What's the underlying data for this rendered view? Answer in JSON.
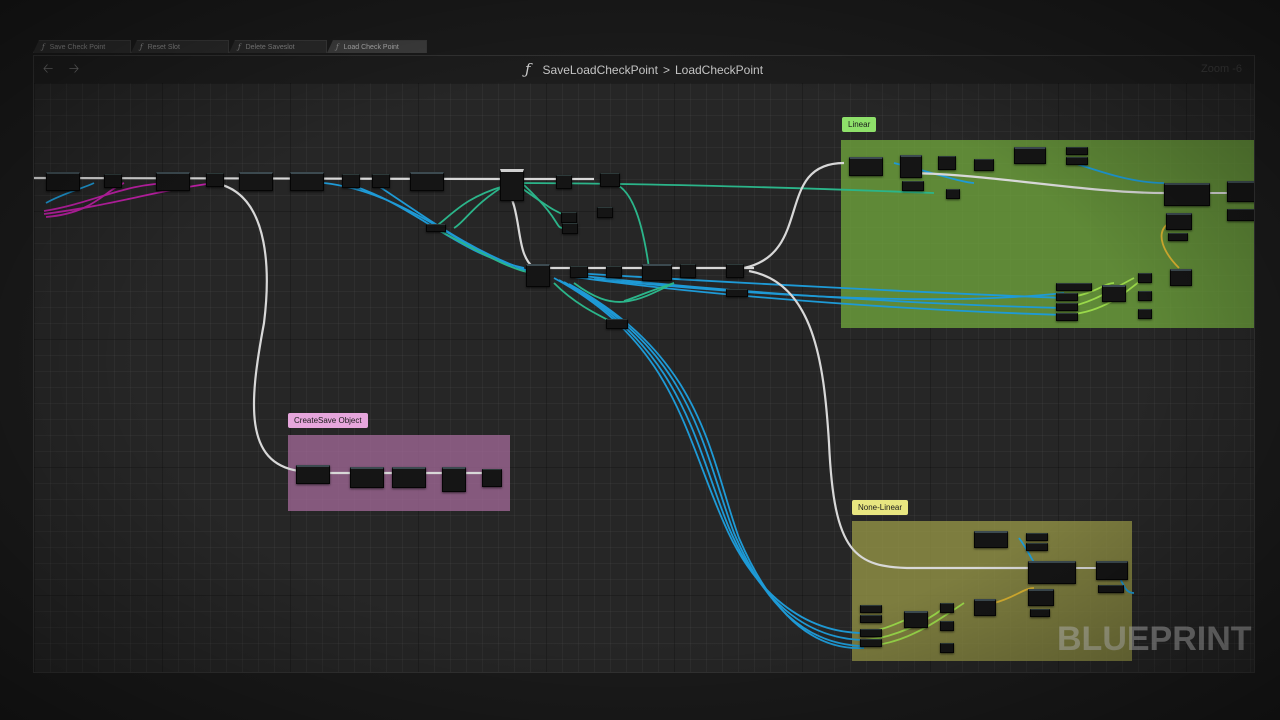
{
  "tabs": [
    {
      "label": "Save Check Point",
      "active": false
    },
    {
      "label": "Reset Slot",
      "active": false
    },
    {
      "label": "Delete Saveslot",
      "active": false
    },
    {
      "label": "Load Check Point",
      "active": true
    }
  ],
  "icons": {
    "function": "ƒ",
    "back": "back-arrow-icon",
    "forward": "forward-arrow-icon"
  },
  "breadcrumb": {
    "function_glyph": "ƒ",
    "parent": "SaveLoadCheckPoint",
    "separator": ">",
    "current": "LoadCheckPoint"
  },
  "zoom_label": "Zoom -6",
  "comments": {
    "linear": "Linear",
    "create_save": "CreateSave Object",
    "non_linear": "None-Linear"
  },
  "watermark": "BLUEPRINT",
  "colors": {
    "exec_wire": "#d8d8d8",
    "object_wire": "#1e9ad6",
    "struct_wire": "#2bb58a",
    "pink_wire": "#c020a8",
    "float_wire": "#9ad94a",
    "linear_comment": "#6a9e3a",
    "create_save_comment": "#b77ab1",
    "non_linear_comment": "#9a9a46"
  }
}
